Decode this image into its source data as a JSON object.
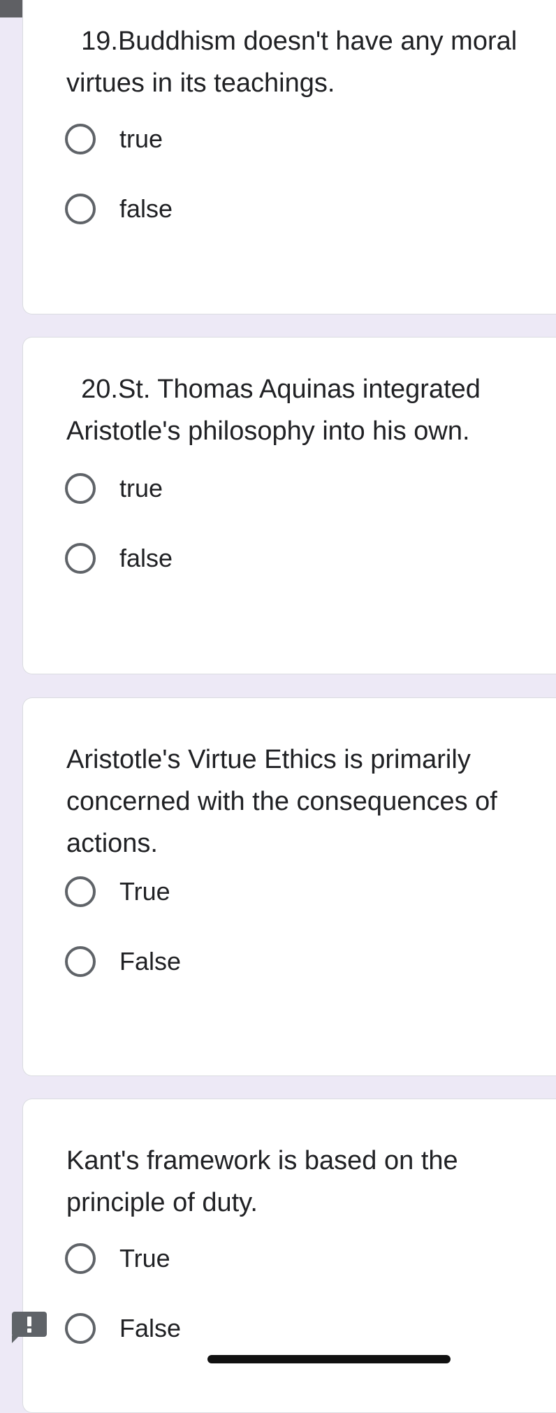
{
  "questions": [
    {
      "text": "  19.Buddhism doesn't have any moral virtues in its teachings.",
      "options": [
        "true",
        "false"
      ]
    },
    {
      "text": "  20.St. Thomas Aquinas integrated Aristotle's philosophy into his own.",
      "options": [
        "true",
        "false"
      ]
    },
    {
      "text": "Aristotle's Virtue Ethics is primarily concerned with the consequences of actions.",
      "options": [
        "True",
        "False"
      ]
    },
    {
      "text": "Kant's framework is based on the principle of duty.",
      "options": [
        "True",
        "False"
      ]
    }
  ],
  "icons": {
    "feedback": "report-issue-icon",
    "radio": "radio-unchecked-icon"
  },
  "colors": {
    "page_background": "#ede9f6",
    "card_background": "#ffffff",
    "radio_border": "#5f6368",
    "top_bar": "#5f6064"
  }
}
